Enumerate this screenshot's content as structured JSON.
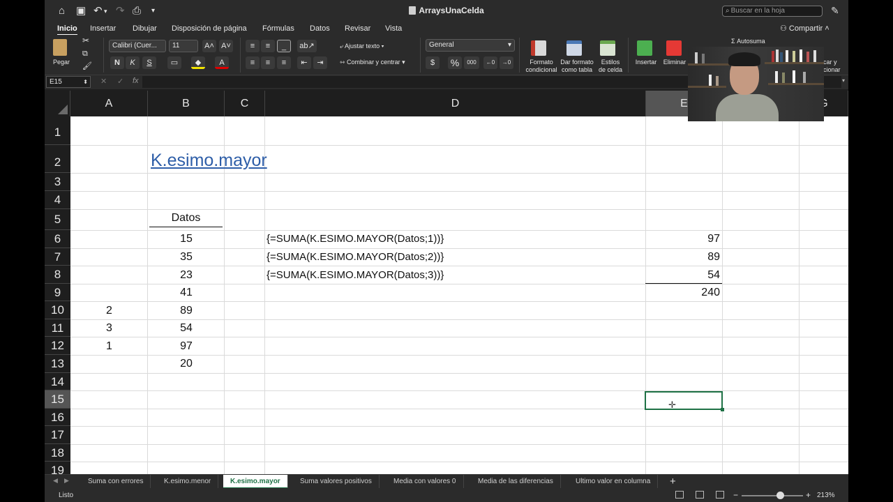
{
  "window": {
    "title": "ArraysUnaCelda",
    "search_placeholder": "Buscar en la hoja"
  },
  "menu": {
    "tabs": [
      "Inicio",
      "Insertar",
      "Dibujar",
      "Disposición de página",
      "Fórmulas",
      "Datos",
      "Revisar",
      "Vista"
    ],
    "active_tab": "Inicio",
    "share_label": "Compartir"
  },
  "ribbon": {
    "paste_label": "Pegar",
    "font_name": "Calibri (Cuer...",
    "font_size": "11",
    "bold": "N",
    "italic": "K",
    "underline": "S",
    "wrap_text": "Ajustar texto",
    "merge_center": "Combinar y centrar",
    "number_format": "General",
    "currency_symbol": "$",
    "percent_symbol": "%",
    "thousands_symbol": "000",
    "cond_format_1": "Formato",
    "cond_format_2": "condicional",
    "table_format_1": "Dar formato",
    "table_format_2": "como tabla",
    "cell_styles_1": "Estilos",
    "cell_styles_2": "de celda",
    "insert_label": "Insertar",
    "delete_label": "Eliminar",
    "autosum_label": "Autosuma",
    "sort_1": "car y",
    "sort_2": "cionar"
  },
  "formula_bar": {
    "cell_ref": "E15",
    "fx_symbol": "fx",
    "formula": ""
  },
  "columns": [
    "A",
    "B",
    "C",
    "D",
    "E",
    "G"
  ],
  "selected_column": "E",
  "rows": [
    "1",
    "2",
    "3",
    "4",
    "5",
    "6",
    "7",
    "8",
    "9",
    "10",
    "11",
    "12",
    "13",
    "14",
    "15",
    "16",
    "17",
    "18",
    "19"
  ],
  "selected_row": "15",
  "sheet": {
    "title": "K.esimo.mayor",
    "datos_header": "Datos",
    "datos": [
      "15",
      "35",
      "23",
      "41",
      "89",
      "54",
      "97",
      "20"
    ],
    "ranks": [
      "2",
      "3",
      "1"
    ],
    "formulas": [
      "{=SUMA(K.ESIMO.MAYOR(Datos;1))}",
      "{=SUMA(K.ESIMO.MAYOR(Datos;2))}",
      "{=SUMA(K.ESIMO.MAYOR(Datos;3))}"
    ],
    "results": [
      "97",
      "89",
      "54"
    ],
    "total": "240"
  },
  "sheet_tabs": [
    "Suma con errores",
    "K.esimo.menor",
    "K.esimo.mayor",
    "Suma valores positivos",
    "Media con valores 0",
    "Media de las diferencias",
    "Ultimo valor en columna"
  ],
  "active_sheet": "K.esimo.mayor",
  "status": {
    "text": "Listo",
    "zoom": "213%",
    "zoom_fraction": 0.62
  },
  "colors": {
    "accent": "#1e7145",
    "link": "#2e5ea8"
  }
}
